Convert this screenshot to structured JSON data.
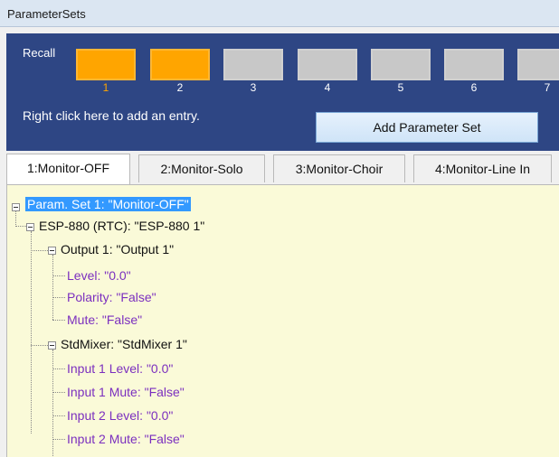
{
  "window": {
    "title": "ParameterSets"
  },
  "recall": {
    "label": "Recall",
    "slots": [
      {
        "number": "1",
        "active": true
      },
      {
        "number": "2",
        "active": true
      },
      {
        "number": "3",
        "active": false
      },
      {
        "number": "4",
        "active": false
      },
      {
        "number": "5",
        "active": false
      },
      {
        "number": "6",
        "active": false
      },
      {
        "number": "7",
        "active": false
      }
    ],
    "hint": "Right click here to add an entry.",
    "add_button": "Add Parameter Set"
  },
  "tabs": [
    {
      "label": "1:Monitor-OFF",
      "active": true
    },
    {
      "label": "2:Monitor-Solo",
      "active": false
    },
    {
      "label": "3:Monitor-Choir",
      "active": false
    },
    {
      "label": "4:Monitor-Line In",
      "active": false
    }
  ],
  "tree": {
    "root": "Param. Set 1: \"Monitor-OFF\"",
    "device": "ESP-880 (RTC): \"ESP-880 1\"",
    "output": "Output 1: \"Output 1\"",
    "output_params": [
      "Level: \"0.0\"",
      "Polarity: \"False\"",
      "Mute: \"False\""
    ],
    "mixer": "StdMixer: \"StdMixer 1\"",
    "mixer_params": [
      "Input 1 Level: \"0.0\"",
      "Input 1 Mute: \"False\"",
      "Input 2 Level: \"0.0\"",
      "Input 2 Mute: \"False\""
    ]
  },
  "colors": {
    "panel": "#2e4684",
    "slot_active": "#ffa500",
    "slot_inactive": "#c8c8c8",
    "tree_background": "#fafad8",
    "leaf_text": "#7b2fbf",
    "selection": "#3399ff"
  }
}
